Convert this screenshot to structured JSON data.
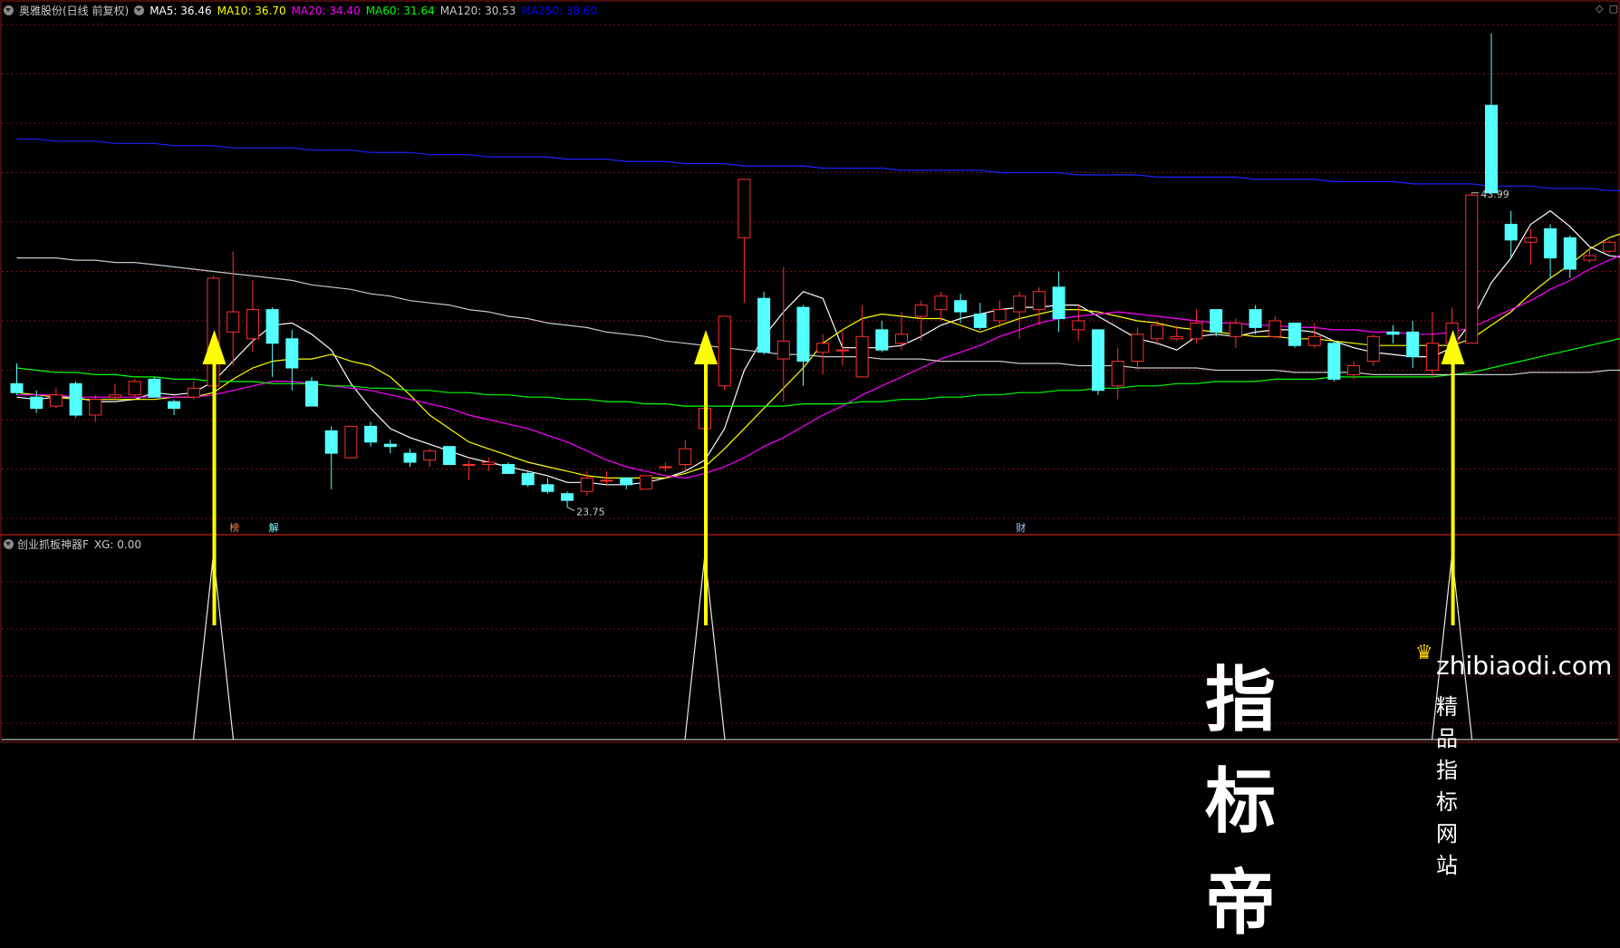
{
  "header": {
    "stock_name": "奥雅股份(日线 前复权)",
    "ma_labels": [
      {
        "text": "MA5: 36.46",
        "color": "#ffffff"
      },
      {
        "text": "MA10: 36.70",
        "color": "#ffff00"
      },
      {
        "text": "MA20: 34.40",
        "color": "#ff00ff"
      },
      {
        "text": "MA60: 31.64",
        "color": "#00ff00"
      },
      {
        "text": "MA120: 30.53",
        "color": "#c8c8c8"
      },
      {
        "text": "MA250: 38.60",
        "color": "#0000ff"
      }
    ]
  },
  "sub_panel": {
    "title": "创业抓板神器F",
    "xg_label": "XG: 0.00"
  },
  "markers": [
    {
      "text": "榜",
      "color": "#ff8040"
    },
    {
      "text": "解",
      "color": "#80ffff"
    },
    {
      "text": "财",
      "color": "#a0c0ff"
    }
  ],
  "annotations": {
    "high_label": "43.99",
    "low_label": "23.75"
  },
  "corner_icons": [
    "diamond-icon",
    "window-icon"
  ],
  "watermark": {
    "brand": "指标帝",
    "url": "zhibiaodi.com",
    "tagline": "精品指标网站"
  },
  "chart_data": {
    "type": "candlestick",
    "ylim": [
      22.5,
      44.3
    ],
    "up_color": "#ff3030",
    "down_color": "#54ffff",
    "candles": [
      [
        28.3,
        27.9,
        29.2,
        27.8
      ],
      [
        27.7,
        27.2,
        28.0,
        27.0
      ],
      [
        27.3,
        27.8,
        28.1,
        27.2
      ],
      [
        28.3,
        26.9,
        28.4,
        26.8
      ],
      [
        26.9,
        27.6,
        27.8,
        26.6
      ],
      [
        27.7,
        27.8,
        28.3,
        27.6
      ],
      [
        27.8,
        28.4,
        28.5,
        27.7
      ],
      [
        28.5,
        27.7,
        28.6,
        27.7
      ],
      [
        27.5,
        27.2,
        27.6,
        26.9
      ],
      [
        27.7,
        28.1,
        28.4,
        27.6
      ],
      [
        28.2,
        33.0,
        33.1,
        27.9
      ],
      [
        30.6,
        31.5,
        34.2,
        29.1
      ],
      [
        30.3,
        31.6,
        32.9,
        29.7
      ],
      [
        31.6,
        30.1,
        31.7,
        28.6
      ],
      [
        30.3,
        29.0,
        30.7,
        28.0
      ],
      [
        28.4,
        27.3,
        28.6,
        27.3
      ],
      [
        26.2,
        25.2,
        26.4,
        23.6
      ],
      [
        25.0,
        26.4,
        26.4,
        25.0
      ],
      [
        26.4,
        25.7,
        26.6,
        25.5
      ],
      [
        25.6,
        25.5,
        25.8,
        25.2
      ],
      [
        25.2,
        24.8,
        25.4,
        24.6
      ],
      [
        24.9,
        25.3,
        25.4,
        24.6
      ],
      [
        25.5,
        24.7,
        25.5,
        24.7
      ],
      [
        24.7,
        24.7,
        24.9,
        24.0
      ],
      [
        24.7,
        24.8,
        25.0,
        24.4
      ],
      [
        24.7,
        24.3,
        24.8,
        24.3
      ],
      [
        24.3,
        23.8,
        24.4,
        23.7
      ],
      [
        23.8,
        23.5,
        24.1,
        23.4
      ],
      [
        23.4,
        23.1,
        23.5,
        22.8
      ],
      [
        23.5,
        24.1,
        24.4,
        23.3
      ],
      [
        24.0,
        24.0,
        24.4,
        23.8
      ],
      [
        24.1,
        23.8,
        24.1,
        23.6
      ],
      [
        23.6,
        24.2,
        24.2,
        23.6
      ],
      [
        24.6,
        24.6,
        24.8,
        24.4
      ],
      [
        24.7,
        25.4,
        25.8,
        24.4
      ],
      [
        26.3,
        27.2,
        27.4,
        25.5
      ],
      [
        28.2,
        31.3,
        31.3,
        28.0
      ],
      [
        34.8,
        37.4,
        37.4,
        31.9
      ],
      [
        32.1,
        29.7,
        32.4,
        29.6
      ],
      [
        29.4,
        30.2,
        33.5,
        27.5
      ],
      [
        31.7,
        29.3,
        31.8,
        28.2
      ],
      [
        29.7,
        30.1,
        30.5,
        28.7
      ],
      [
        29.8,
        29.8,
        30.7,
        29.1
      ],
      [
        28.6,
        30.4,
        31.8,
        28.6
      ],
      [
        30.7,
        29.8,
        31.1,
        29.7
      ],
      [
        30.1,
        30.5,
        31.5,
        29.8
      ],
      [
        31.3,
        31.8,
        32.0,
        30.2
      ],
      [
        31.6,
        32.2,
        32.4,
        31.1
      ],
      [
        32.0,
        31.5,
        32.3,
        31.0
      ],
      [
        31.4,
        30.8,
        31.9,
        30.7
      ],
      [
        31.1,
        31.6,
        32.0,
        30.8
      ],
      [
        31.5,
        32.2,
        32.4,
        30.3
      ],
      [
        31.6,
        32.4,
        32.6,
        30.9
      ],
      [
        32.6,
        31.2,
        33.3,
        30.6
      ],
      [
        30.7,
        31.1,
        31.8,
        30.2
      ],
      [
        30.7,
        28.0,
        30.7,
        27.8
      ],
      [
        28.2,
        29.3,
        29.9,
        27.6
      ],
      [
        29.3,
        30.5,
        30.8,
        28.9
      ],
      [
        30.3,
        30.9,
        31.1,
        30.0
      ],
      [
        30.3,
        30.4,
        30.9,
        30.2
      ],
      [
        30.3,
        31.0,
        31.6,
        30.1
      ],
      [
        31.6,
        30.6,
        31.6,
        30.4
      ],
      [
        30.4,
        31.0,
        31.2,
        29.9
      ],
      [
        31.6,
        30.8,
        31.8,
        30.5
      ],
      [
        30.4,
        31.1,
        31.3,
        30.3
      ],
      [
        31.0,
        30.0,
        31.0,
        29.9
      ],
      [
        30.0,
        30.4,
        31.0,
        29.9
      ],
      [
        30.1,
        28.5,
        30.2,
        28.4
      ],
      [
        28.7,
        29.1,
        29.3,
        28.5
      ],
      [
        29.3,
        30.4,
        30.5,
        29.1
      ],
      [
        30.6,
        30.5,
        30.9,
        30.1
      ],
      [
        30.6,
        29.5,
        31.1,
        29.0
      ],
      [
        28.9,
        30.1,
        31.5,
        28.6
      ],
      [
        30.1,
        31.0,
        31.7,
        30.1
      ],
      [
        30.1,
        36.7,
        36.8,
        30.1
      ],
      [
        40.7,
        36.8,
        43.9,
        36.8
      ],
      [
        35.4,
        34.7,
        36.0,
        33.9
      ],
      [
        34.6,
        34.8,
        35.2,
        33.6
      ],
      [
        35.2,
        33.9,
        35.4,
        33.0
      ],
      [
        34.8,
        33.4,
        34.9,
        33.0
      ],
      [
        33.8,
        34.0,
        34.4,
        33.7
      ],
      [
        34.2,
        34.6,
        34.7,
        34.1
      ],
      [
        34.3,
        33.9,
        34.5,
        33.4
      ]
    ],
    "series": [
      {
        "name": "MA5",
        "color": "#ffffff",
        "values": [
          27.7,
          27.6,
          27.7,
          27.7,
          27.5,
          27.5,
          27.6,
          27.9,
          27.8,
          27.9,
          28.4,
          29.3,
          30.2,
          30.9,
          31.0,
          30.5,
          29.8,
          28.3,
          27.2,
          26.3,
          25.9,
          25.6,
          25.3,
          25.0,
          24.8,
          24.6,
          24.4,
          24.2,
          23.9,
          23.9,
          23.8,
          23.8,
          23.9,
          24.1,
          24.4,
          24.9,
          26.3,
          28.9,
          30.4,
          31.5,
          32.4,
          32.1,
          29.9,
          29.9,
          29.9,
          30.0,
          30.4,
          30.9,
          31.2,
          31.4,
          31.6,
          31.7,
          31.7,
          31.8,
          31.8,
          31.3,
          30.8,
          30.3,
          30.1,
          29.8,
          30.4,
          30.5,
          30.4,
          30.6,
          30.7,
          30.7,
          30.6,
          30.2,
          29.9,
          29.7,
          29.6,
          29.5,
          29.5,
          29.9,
          31.1,
          32.8,
          33.9,
          35.4,
          36.0,
          35.3,
          34.4,
          34.0,
          33.9
        ]
      },
      {
        "name": "MA10",
        "color": "#ffff00",
        "values": [
          27.9,
          27.8,
          27.7,
          27.6,
          27.6,
          27.6,
          27.6,
          27.6,
          27.7,
          27.7,
          27.9,
          28.5,
          29.0,
          29.3,
          29.4,
          29.4,
          29.6,
          29.3,
          29.1,
          28.6,
          27.8,
          26.9,
          26.3,
          25.7,
          25.4,
          25.1,
          24.8,
          24.6,
          24.4,
          24.2,
          24.1,
          24.1,
          24.1,
          24.1,
          24.3,
          24.6,
          25.4,
          26.3,
          27.2,
          28.1,
          29.0,
          30.1,
          30.7,
          31.2,
          31.4,
          31.3,
          31.2,
          31.2,
          30.9,
          30.6,
          30.9,
          31.2,
          31.4,
          31.6,
          31.6,
          31.5,
          31.3,
          31.1,
          31.0,
          30.8,
          30.7,
          30.6,
          30.5,
          30.4,
          30.4,
          30.3,
          30.3,
          30.2,
          30.1,
          30.0,
          30.0,
          30.0,
          30.0,
          30.0,
          30.3,
          30.9,
          31.5,
          32.3,
          33.0,
          33.6,
          34.3,
          34.8,
          35.1
        ]
      },
      {
        "name": "MA20",
        "color": "#ff00ff",
        "values": [
          27.8,
          27.8,
          27.8,
          27.7,
          27.7,
          27.7,
          27.7,
          27.7,
          27.7,
          27.7,
          27.8,
          28.0,
          28.2,
          28.4,
          28.4,
          28.3,
          28.2,
          28.1,
          28.0,
          27.8,
          27.6,
          27.4,
          27.2,
          26.9,
          26.7,
          26.5,
          26.3,
          26.0,
          25.7,
          25.3,
          24.9,
          24.6,
          24.4,
          24.2,
          24.1,
          24.3,
          24.6,
          25.0,
          25.5,
          25.9,
          26.4,
          26.9,
          27.3,
          27.8,
          28.2,
          28.6,
          29.0,
          29.4,
          29.7,
          30.0,
          30.4,
          30.7,
          31.0,
          31.2,
          31.3,
          31.4,
          31.5,
          31.4,
          31.3,
          31.2,
          31.1,
          31.0,
          31.0,
          30.9,
          30.9,
          30.8,
          30.8,
          30.7,
          30.7,
          30.6,
          30.6,
          30.5,
          30.5,
          30.6,
          30.8,
          31.2,
          31.6,
          32.0,
          32.5,
          32.9,
          33.4,
          33.8,
          34.2
        ]
      },
      {
        "name": "MA60",
        "color": "#00ff00",
        "values": [
          29.0,
          28.9,
          28.8,
          28.8,
          28.7,
          28.7,
          28.6,
          28.6,
          28.5,
          28.5,
          28.4,
          28.4,
          28.4,
          28.3,
          28.3,
          28.3,
          28.2,
          28.2,
          28.1,
          28.1,
          28.0,
          28.0,
          27.9,
          27.9,
          27.8,
          27.8,
          27.7,
          27.7,
          27.6,
          27.6,
          27.5,
          27.5,
          27.4,
          27.4,
          27.3,
          27.3,
          27.3,
          27.3,
          27.3,
          27.3,
          27.4,
          27.4,
          27.4,
          27.5,
          27.5,
          27.6,
          27.6,
          27.7,
          27.7,
          27.8,
          27.8,
          27.9,
          27.9,
          28.0,
          28.0,
          28.1,
          28.1,
          28.2,
          28.2,
          28.3,
          28.3,
          28.4,
          28.4,
          28.4,
          28.5,
          28.5,
          28.5,
          28.6,
          28.6,
          28.6,
          28.6,
          28.6,
          28.6,
          28.7,
          28.8,
          29.0,
          29.2,
          29.4,
          29.6,
          29.8,
          30.0,
          30.2,
          30.4
        ]
      },
      {
        "name": "MA120",
        "color": "#c8c8c8",
        "values": [
          33.9,
          33.9,
          33.9,
          33.8,
          33.8,
          33.7,
          33.7,
          33.6,
          33.5,
          33.4,
          33.3,
          33.2,
          33.1,
          33.0,
          32.9,
          32.7,
          32.6,
          32.5,
          32.3,
          32.2,
          32.0,
          31.9,
          31.8,
          31.6,
          31.5,
          31.3,
          31.2,
          31.0,
          30.9,
          30.8,
          30.6,
          30.5,
          30.4,
          30.2,
          30.1,
          30.0,
          29.9,
          29.8,
          29.7,
          29.6,
          29.6,
          29.5,
          29.5,
          29.5,
          29.4,
          29.4,
          29.4,
          29.3,
          29.3,
          29.3,
          29.3,
          29.2,
          29.2,
          29.2,
          29.1,
          29.1,
          29.1,
          29.0,
          29.0,
          29.0,
          29.0,
          28.9,
          28.9,
          28.9,
          28.9,
          28.8,
          28.8,
          28.8,
          28.8,
          28.7,
          28.7,
          28.7,
          28.7,
          28.7,
          28.7,
          28.7,
          28.7,
          28.8,
          28.8,
          28.8,
          28.8,
          28.9,
          28.9
        ]
      },
      {
        "name": "MA250",
        "color": "#2020ff",
        "values": [
          39.2,
          39.2,
          39.1,
          39.1,
          39.1,
          39.0,
          39.0,
          39.0,
          38.9,
          38.9,
          38.9,
          38.8,
          38.8,
          38.8,
          38.8,
          38.7,
          38.7,
          38.7,
          38.6,
          38.6,
          38.6,
          38.5,
          38.5,
          38.5,
          38.4,
          38.4,
          38.4,
          38.4,
          38.3,
          38.3,
          38.3,
          38.2,
          38.2,
          38.2,
          38.1,
          38.1,
          38.1,
          38.0,
          38.0,
          38.0,
          38.0,
          37.9,
          37.9,
          37.9,
          37.9,
          37.8,
          37.8,
          37.8,
          37.8,
          37.8,
          37.7,
          37.7,
          37.7,
          37.7,
          37.6,
          37.6,
          37.6,
          37.6,
          37.5,
          37.5,
          37.5,
          37.5,
          37.5,
          37.4,
          37.4,
          37.4,
          37.4,
          37.3,
          37.3,
          37.3,
          37.3,
          37.2,
          37.2,
          37.2,
          37.2,
          37.1,
          37.1,
          37.1,
          37.0,
          37.0,
          37.0,
          36.9,
          36.9
        ]
      }
    ],
    "signal_spikes_at": [
      10,
      35,
      73
    ],
    "arrows_at": [
      10,
      35,
      73
    ],
    "marker_positions": [
      11,
      13,
      51
    ],
    "high_index": 74,
    "low_index": 28
  }
}
